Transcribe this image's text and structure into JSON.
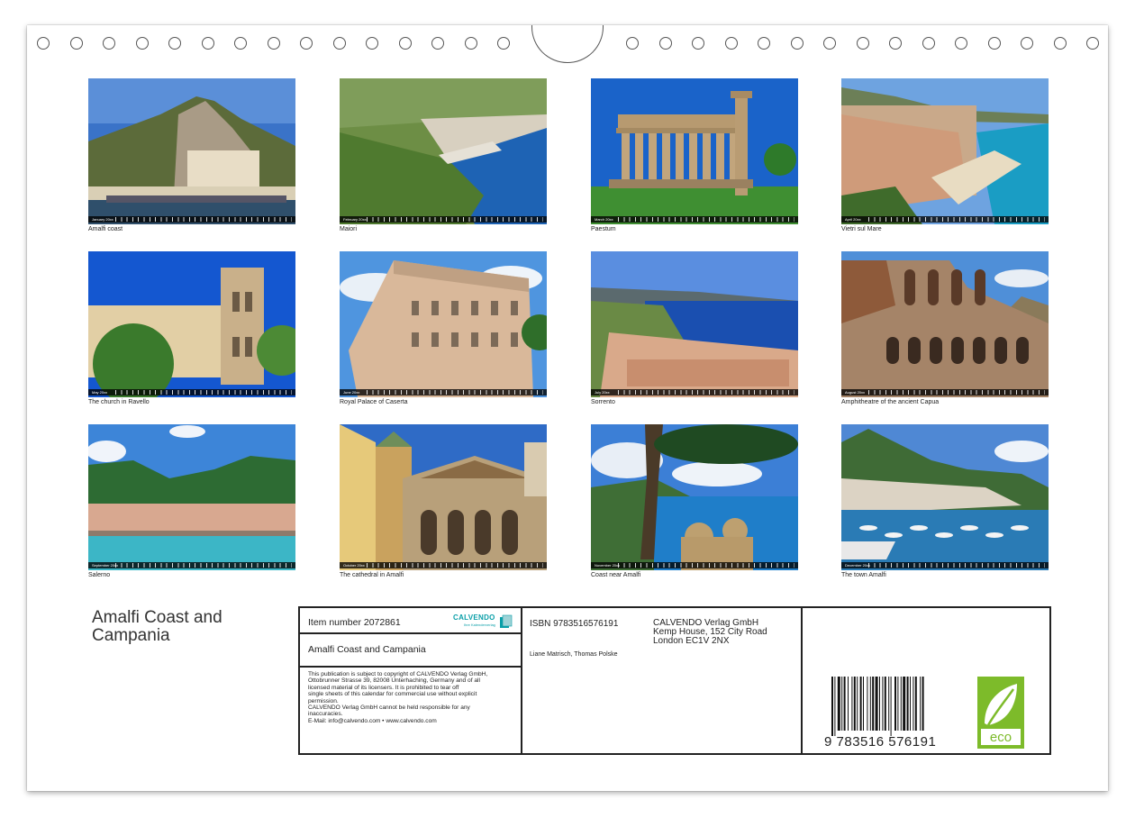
{
  "months": [
    {
      "caption": "Amalfi coast",
      "strip": "January 20xx"
    },
    {
      "caption": "Maiori",
      "strip": "February 20xx"
    },
    {
      "caption": "Paestum",
      "strip": "March 20xx"
    },
    {
      "caption": "Vietri sul Mare",
      "strip": "April 20xx"
    },
    {
      "caption": "The church in Ravello",
      "strip": "May 20xx"
    },
    {
      "caption": "Royal Palace of Caserta",
      "strip": "June 20xx"
    },
    {
      "caption": "Sorrento",
      "strip": "July 20xx"
    },
    {
      "caption": "Amphitheatre of the ancient Capua",
      "strip": "August 20xx"
    },
    {
      "caption": "Salerno",
      "strip": "September 20xx"
    },
    {
      "caption": "The cathedral in Amalfi",
      "strip": "October 20xx"
    },
    {
      "caption": "Coast near Amalfi",
      "strip": "November 20xx"
    },
    {
      "caption": "The town Amalfi",
      "strip": "December 20xx"
    }
  ],
  "calendar_title": "Amalfi Coast and Campania",
  "info": {
    "item_number": "Item number 2072861",
    "title": "Amalfi Coast and Campania",
    "calvendo_logo_text": "CALVENDO",
    "calvendo_logo_sub": "Ihre Kalenderverlag",
    "legal": [
      "This publication is subject to copyright of CALVENDO Verlag GmbH,",
      "Ottobrunner Strasse 39, 82008 Unterhaching, Germany and of all",
      "licensed material of its licensers. It is prohibited to tear off",
      "single sheets of this calendar for commercial use without explicit",
      "permission.",
      "CALVENDO Verlag GmbH cannot be held responsible for any",
      "inaccuracies.",
      "E-Mail: info@calvendo.com • www.calvendo.com"
    ],
    "isbn": "ISBN 9783516576191",
    "authors": "Liane Matrisch, Thomas Polske",
    "publisher": [
      "CALVENDO Verlag GmbH",
      "Kemp House, 152 City Road",
      "London EC1V 2NX"
    ],
    "barcode_number": "9 783516 576191",
    "eco_label": "eco"
  },
  "colors": {
    "eco_green": "#7dbb2a",
    "calvendo_teal": "#0a9fa8"
  }
}
